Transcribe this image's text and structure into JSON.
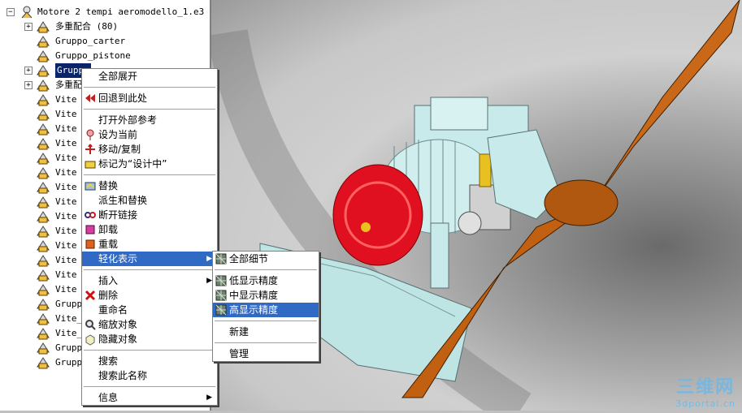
{
  "tree": {
    "root_label": "Motore 2 tempi aeromodello_1.e3",
    "items": [
      {
        "label": "多重配合 (80)",
        "expand": true
      },
      {
        "label": "Gruppo_carter",
        "expand": false
      },
      {
        "label": "Gruppo_pistone",
        "expand": false
      },
      {
        "label": "Gruppo",
        "expand": true,
        "selected": true
      },
      {
        "label": "多重配",
        "expand": true
      },
      {
        "label": "Vite",
        "expand": false
      },
      {
        "label": "Vite",
        "expand": false
      },
      {
        "label": "Vite",
        "expand": false
      },
      {
        "label": "Vite",
        "expand": false
      },
      {
        "label": "Vite",
        "expand": false
      },
      {
        "label": "Vite",
        "expand": false
      },
      {
        "label": "Vite",
        "expand": false
      },
      {
        "label": "Vite",
        "expand": false
      },
      {
        "label": "Vite",
        "expand": false
      },
      {
        "label": "Vite",
        "expand": false
      },
      {
        "label": "Vite",
        "expand": false
      },
      {
        "label": "Vite",
        "expand": false
      },
      {
        "label": "Vite",
        "expand": false
      },
      {
        "label": "Vite",
        "expand": false
      },
      {
        "label": "Grupp",
        "expand": false
      },
      {
        "label": "Vite_",
        "expand": false
      },
      {
        "label": "Vite_",
        "expand": false
      },
      {
        "label": "Grupp",
        "expand": false
      },
      {
        "label": "Grupp",
        "expand": false
      }
    ]
  },
  "context_menu": {
    "items": [
      {
        "label": "全部展开",
        "icon": ""
      },
      {
        "sep": true
      },
      {
        "label": "回退到此处",
        "icon": "rewind-icon"
      },
      {
        "sep": true
      },
      {
        "label": "打开外部参考",
        "icon": ""
      },
      {
        "label": "设为当前",
        "icon": "pin-icon"
      },
      {
        "label": "移动/复制",
        "icon": "move-copy-icon"
      },
      {
        "label": "标记为“设计中”",
        "icon": "design-mark-icon"
      },
      {
        "sep": true
      },
      {
        "label": "替换",
        "icon": "replace-icon"
      },
      {
        "label": "派生和替换",
        "icon": ""
      },
      {
        "label": "断开链接",
        "icon": "break-link-icon"
      },
      {
        "label": "卸载",
        "icon": "unload-icon"
      },
      {
        "label": "重载",
        "icon": "reload-icon"
      },
      {
        "label": "轻化表示",
        "icon": "",
        "submenu": true,
        "highlighted": true
      },
      {
        "sep": true
      },
      {
        "label": "插入",
        "icon": "",
        "submenu": true
      },
      {
        "label": "删除",
        "icon": "delete-icon"
      },
      {
        "label": "重命名",
        "icon": ""
      },
      {
        "label": "缩放对象",
        "icon": "zoom-object-icon"
      },
      {
        "label": "隐藏对象",
        "icon": "hide-object-icon"
      },
      {
        "sep": true
      },
      {
        "label": "搜索",
        "icon": ""
      },
      {
        "label": "搜索此名称",
        "icon": ""
      },
      {
        "sep": true
      },
      {
        "label": "信息",
        "icon": "",
        "submenu": true
      }
    ]
  },
  "submenu": {
    "items": [
      {
        "label": "全部细节",
        "icon": "mesh-icon"
      },
      {
        "sep": true
      },
      {
        "label": "低显示精度",
        "icon": "mesh-icon"
      },
      {
        "label": "中显示精度",
        "icon": "mesh-icon"
      },
      {
        "label": "高显示精度",
        "icon": "mesh-icon",
        "highlighted": true
      },
      {
        "sep": true
      },
      {
        "label": "新建",
        "icon": ""
      },
      {
        "sep": true
      },
      {
        "label": "管理",
        "icon": ""
      }
    ]
  },
  "watermark": {
    "big": "三维网",
    "small": "3dportal.cn"
  },
  "colors": {
    "menu_highlight": "#316ac5",
    "tree_selection": "#0a246a",
    "propeller": "#c06010",
    "engine": "#bfe4e4",
    "cylinder_head": "#e01020"
  }
}
